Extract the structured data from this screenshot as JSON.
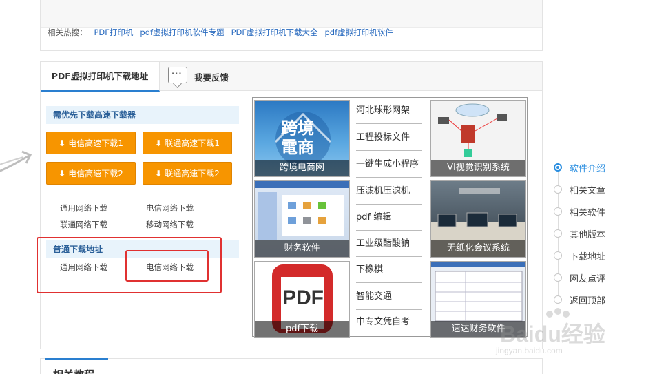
{
  "hot_search": {
    "label": "相关热搜：",
    "links": [
      "PDF打印机",
      "pdf虚拟打印机软件专题",
      "PDF虚拟打印机下载大全",
      "pdf虚拟打印机软件"
    ]
  },
  "tabs": {
    "active": "PDF虚拟打印机下载地址",
    "feedback": "我要反馈",
    "feedback_dots": "···"
  },
  "priority": {
    "heading": "需优先下载高速下载器",
    "buttons": [
      "电信高速下载1",
      "联通高速下载1",
      "电信高速下载2",
      "联通高速下载2"
    ],
    "links": [
      "通用网络下载",
      "电信网络下载",
      "联通网络下载",
      "移动网络下载"
    ]
  },
  "normal": {
    "heading": "普通下载地址",
    "links": [
      "通用网络下载",
      "电信网络下载"
    ]
  },
  "ads": {
    "tiles": [
      {
        "caption": "跨境电商网",
        "art": "跨境\n電商"
      },
      {
        "caption": "VI视觉识别系统"
      },
      {
        "caption": "财务软件"
      },
      {
        "caption": "无纸化会议系统"
      },
      {
        "caption": "pdf下载",
        "art": "PDF"
      },
      {
        "caption": "速达财务软件"
      }
    ],
    "links": [
      "河北球形网架",
      "工程投标文件",
      "一键生成小程序",
      "压滤机压滤机",
      "pdf 编辑",
      "工业级醋酸钠",
      "下橡棋",
      "智能交通",
      "中专文凭自考"
    ]
  },
  "side_nav": {
    "items": [
      "软件介绍",
      "相关文章",
      "相关软件",
      "其他版本",
      "下载地址",
      "网友点评",
      "返回顶部"
    ],
    "active_index": 0
  },
  "bottom": {
    "title": "相关教程"
  },
  "watermark": {
    "brand": "Baidu经验",
    "url": "jingyan.baidu.com"
  },
  "colors": {
    "button_orange": "#f79500",
    "link_blue": "#2a6bbf",
    "active_blue": "#2a8ee0",
    "highlight_red": "#e03131"
  }
}
